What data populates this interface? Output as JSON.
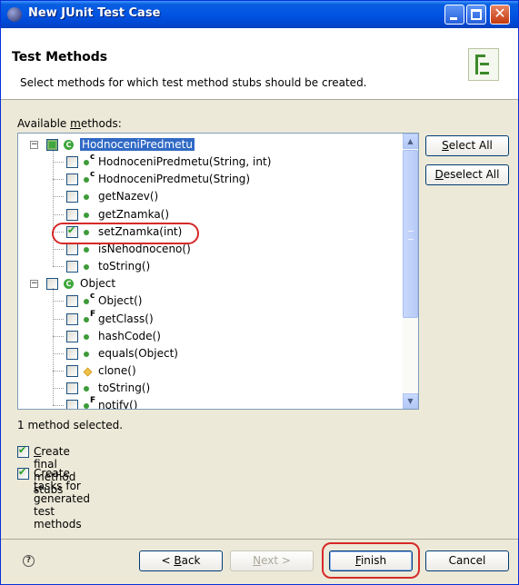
{
  "window": {
    "title": "New JUnit Test Case"
  },
  "header": {
    "title": "Test Methods",
    "description": "Select methods for which test method stubs should be created."
  },
  "tree": {
    "label_pre": "Available ",
    "label_u": "m",
    "label_post": "ethods:",
    "groups": [
      {
        "name": "HodnoceniPredmetu",
        "items": [
          {
            "label": "HodnoceniPredmetu(String, int)",
            "checked": false,
            "decoration": "c"
          },
          {
            "label": "HodnoceniPredmetu(String)",
            "checked": false,
            "decoration": "c"
          },
          {
            "label": "getNazev()",
            "checked": false,
            "decoration": ""
          },
          {
            "label": "getZnamka()",
            "checked": false,
            "decoration": ""
          },
          {
            "label": "setZnamka(int)",
            "checked": true,
            "decoration": ""
          },
          {
            "label": "isNehodnoceno()",
            "checked": false,
            "decoration": ""
          },
          {
            "label": "toString()",
            "checked": false,
            "decoration": ""
          }
        ]
      },
      {
        "name": "Object",
        "items": [
          {
            "label": "Object()",
            "checked": false,
            "decoration": "c"
          },
          {
            "label": "getClass()",
            "checked": false,
            "decoration": "F"
          },
          {
            "label": "hashCode()",
            "checked": false,
            "decoration": ""
          },
          {
            "label": "equals(Object)",
            "checked": false,
            "decoration": ""
          },
          {
            "label": "clone()",
            "checked": false,
            "decoration": ""
          },
          {
            "label": "toString()",
            "checked": false,
            "decoration": ""
          },
          {
            "label": "notify()",
            "checked": false,
            "decoration": "F"
          }
        ]
      }
    ]
  },
  "buttons": {
    "select_all_u": "S",
    "select_all_rest": "elect All",
    "deselect_all_u": "D",
    "deselect_all_rest": "eselect All",
    "back_pre": "< ",
    "back_u": "B",
    "back_post": "ack",
    "next_u": "N",
    "next_post": "ext >",
    "finish_u": "F",
    "finish_post": "inish",
    "cancel": "Cancel"
  },
  "status": "1 method selected.",
  "options": [
    {
      "u": "C",
      "rest": "reate final method stubs",
      "checked": true
    },
    {
      "pre": "Create ",
      "u": "t",
      "rest": "asks for generated test methods",
      "checked": true
    }
  ],
  "colors": {
    "titlebar": "#0054e3",
    "dialog_bg": "#ece9d8",
    "highlight": "#d62929",
    "selection": "#316ac5"
  }
}
